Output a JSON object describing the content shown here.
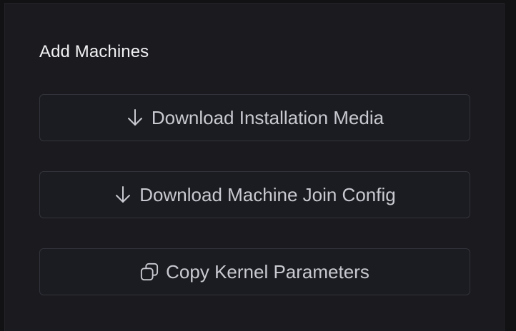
{
  "section": {
    "title": "Add Machines"
  },
  "actions": [
    {
      "label": "Download Installation Media",
      "icon": "download-arrow-icon"
    },
    {
      "label": "Download Machine Join Config",
      "icon": "download-arrow-icon"
    },
    {
      "label": "Copy Kernel Parameters",
      "icon": "copy-icon"
    }
  ],
  "colors": {
    "background": "#121214",
    "panel": "#1a1a1f",
    "button_bg": "#1b1c21",
    "button_border": "#33343b",
    "button_text": "#c9cad1",
    "title_text": "#f2f2f4"
  }
}
